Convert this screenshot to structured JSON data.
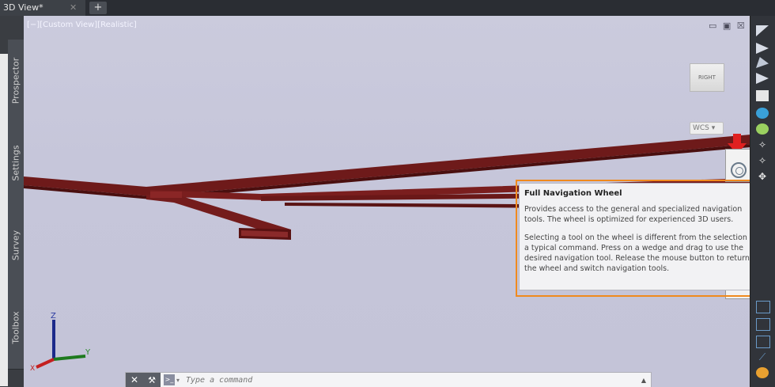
{
  "tabs": [
    {
      "label": "3D View*"
    }
  ],
  "left_panel": {
    "tabs": [
      "Prospector",
      "Settings",
      "Survey",
      "Toolbox"
    ]
  },
  "viewport": {
    "label": "[−][Custom View][Realistic]",
    "viewcube_face": "RIGHT",
    "wcs_label": "WCS",
    "ucs": {
      "z": "Z",
      "y": "Y",
      "x": "X"
    }
  },
  "tooltip": {
    "title": "Full Navigation Wheel",
    "paragraph1": "Provides access to the general and specialized navigation tools. The wheel is optimized for experienced 3D users.",
    "paragraph2": "Selecting a tool on the wheel is different from the selection of a typical command. Press on a wedge and drag to use the desired navigation tool. Release the mouse button to return to the wheel and switch navigation tools."
  },
  "command_line": {
    "placeholder": "Type a command"
  },
  "colors": {
    "highlight": "#f08a1e",
    "arrow": "#e02020",
    "beam": "#6e1a1a",
    "viewport_bg": "#c6c6da"
  }
}
